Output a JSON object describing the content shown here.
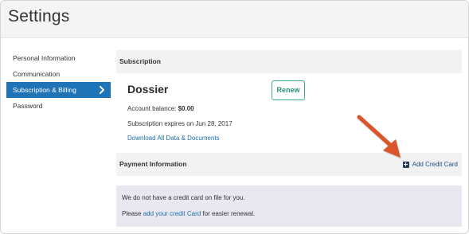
{
  "header": {
    "title": "Settings"
  },
  "sidebar": {
    "items": [
      {
        "label": "Personal Information",
        "active": false
      },
      {
        "label": "Communication",
        "active": false
      },
      {
        "label": "Subscription & Billing",
        "active": true
      },
      {
        "label": "Password",
        "active": false
      }
    ]
  },
  "subscription": {
    "section_title": "Subscription",
    "plan_name": "Dossier",
    "renew_label": "Renew",
    "balance_label": "Account balance:",
    "balance_value": "$0.00",
    "expires_text": "Subscription expires on Jun 28, 2017",
    "download_link": "Download All Data & Documents"
  },
  "payment": {
    "section_title": "Payment Information",
    "add_card_label": "Add Credit Card",
    "notice_line1": "We do not have a credit card on file for you.",
    "notice_line2_prefix": "Please",
    "notice_line2_link": "add your credit Card",
    "notice_line2_suffix": "for easier renewal."
  },
  "colors": {
    "accent": "#1f73b7",
    "renew_border": "#3aa98f",
    "arrow": "#d9542a",
    "notice_bg": "#e9e8f1"
  },
  "icons": {
    "chevron": "chevron-right-icon",
    "add": "plus-square-icon",
    "annotation": "arrow-icon"
  }
}
